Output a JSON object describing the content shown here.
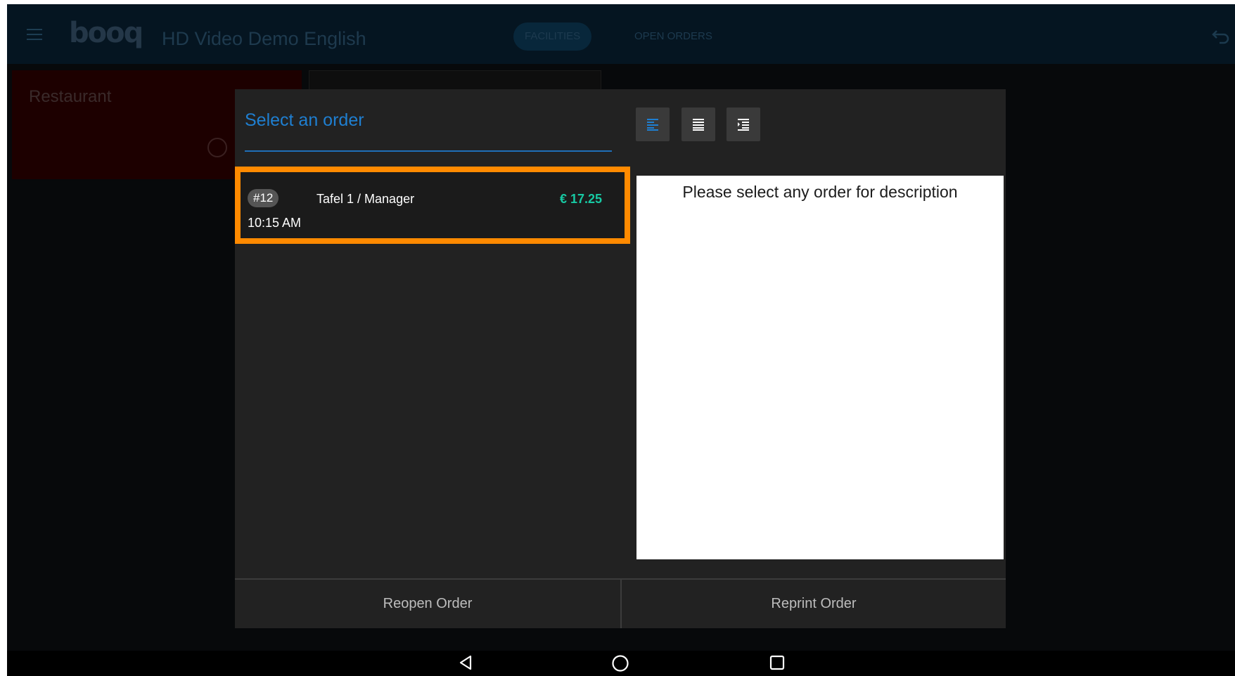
{
  "app": {
    "logo_text": "booq",
    "title": "HD Video Demo English",
    "tabs": [
      "FACILITIES",
      "OPEN ORDERS"
    ]
  },
  "background": {
    "area_title": "Restaurant"
  },
  "dialog": {
    "title": "Select an order",
    "toolbar_icons": [
      "align-left-icon",
      "align-justify-icon",
      "indent-icon"
    ],
    "order": {
      "number": "#12",
      "name": "Tafel 1 / Manager",
      "price": "€ 17.25",
      "time": "10:15 AM"
    },
    "description_placeholder": "Please select any order for description",
    "buttons": {
      "reopen": "Reopen Order",
      "reprint": "Reprint Order"
    }
  },
  "colors": {
    "accent": "#1f7fd1",
    "price": "#17c9a3",
    "highlight": "#ff8a00",
    "dialog_bg": "#222222"
  },
  "navbar": {
    "icons": [
      "back-triangle-icon",
      "home-circle-icon",
      "recents-square-icon"
    ]
  }
}
